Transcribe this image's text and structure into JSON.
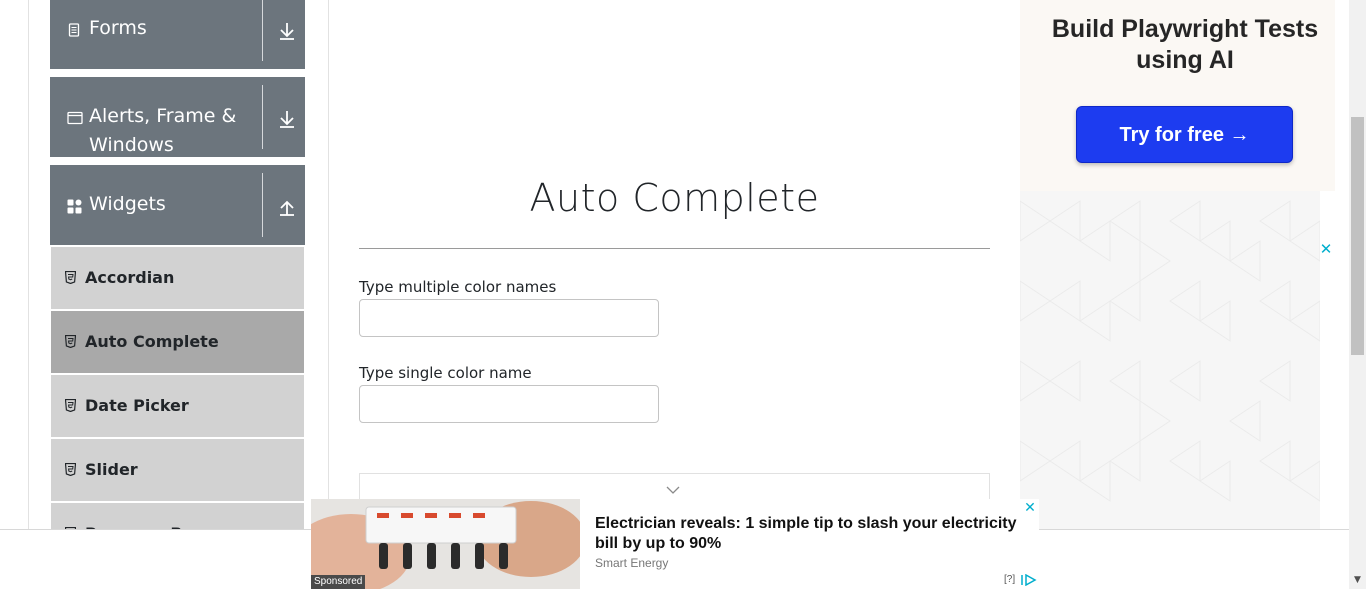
{
  "sidebar": {
    "groups": [
      {
        "title": "Forms",
        "icon": "file-text-icon",
        "arrow": "download-arrow-icon"
      },
      {
        "title": "Alerts, Frame & Windows",
        "icon": "window-icon",
        "arrow": "download-arrow-icon"
      },
      {
        "title": "Widgets",
        "icon": "widgets-grid-icon",
        "arrow": "upload-arrow-icon"
      }
    ],
    "items": [
      {
        "label": "Accordian",
        "active": false
      },
      {
        "label": "Auto Complete",
        "active": true
      },
      {
        "label": "Date Picker",
        "active": false
      },
      {
        "label": "Slider",
        "active": false
      },
      {
        "label": "Progress Bar",
        "active": false
      }
    ]
  },
  "main": {
    "title": "Auto Complete",
    "fields": [
      {
        "label": "Type multiple color names",
        "value": "",
        "placeholder": ""
      },
      {
        "label": "Type single color name",
        "value": "",
        "placeholder": ""
      }
    ]
  },
  "ad_right": {
    "headline": "Build Playwright Tests using AI",
    "button": "Try for free →",
    "close": "✕",
    "accent": "#1d3cf0"
  },
  "ad_bottom": {
    "sponsored": "Sponsored",
    "headline": "Electrician reveals: 1 simple tip to slash your electricity bill by up to 90%",
    "brand": "Smart Energy",
    "close": "✕",
    "help": "[?]"
  },
  "colors": {
    "sidebar_group": "#6c757d",
    "sidebar_item": "#d2d2d2",
    "sidebar_item_active": "#a9a9a9",
    "close_accent": "#00aecd"
  }
}
